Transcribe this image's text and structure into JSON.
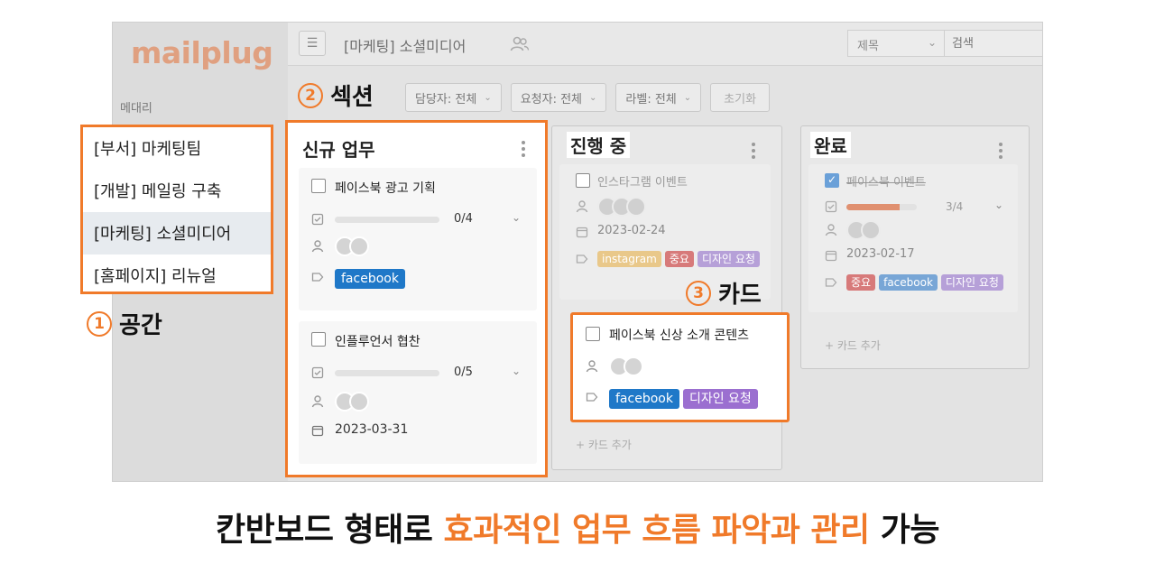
{
  "app": {
    "logo": "mailplug",
    "sidebar_label": "메대리"
  },
  "topbar": {
    "space_title": "[마케팅] 소셜미디어",
    "search_select": "제목",
    "search_placeholder": "검색",
    "icons": [
      "menu-collapse-icon",
      "people-icon",
      "chevron-down-icon"
    ]
  },
  "filters": [
    {
      "label": "담당자: 전체"
    },
    {
      "label": "요청자: 전체"
    },
    {
      "label": "라벨: 전체"
    }
  ],
  "reset_label": "초기화",
  "spaces": [
    {
      "label": "[부서] 마케팅팀",
      "active": false
    },
    {
      "label": "[개발] 메일링 구축",
      "active": false
    },
    {
      "label": "[마케팅] 소셜미디어",
      "active": true
    },
    {
      "label": "[홈페이지] 리뉴얼",
      "active": false
    }
  ],
  "columns": {
    "new": {
      "title": "신규 업무",
      "cards": [
        {
          "title": "페이스북 광고 기획",
          "progress_text": "0/4",
          "progress": 0,
          "tags": [
            {
              "label": "facebook",
              "color": "#1f78c8"
            }
          ]
        },
        {
          "title": "인플루언서 협찬",
          "progress_text": "0/5",
          "progress": 0,
          "date": "2023-03-31"
        }
      ]
    },
    "doing": {
      "title": "진행 중",
      "add_label": "+ 카드 추가",
      "cards": [
        {
          "title": "인스타그램 이벤트",
          "date": "2023-02-24",
          "tags": [
            {
              "label": "instagram",
              "color": "#e9c88a"
            },
            {
              "label": "중요",
              "color": "#d77a7a"
            },
            {
              "label": "디자인 요청",
              "color": "#b6a0d8"
            }
          ]
        },
        {
          "title": "페이스북 신상 소개 콘텐츠",
          "tags": [
            {
              "label": "facebook",
              "color": "#1f78c8"
            },
            {
              "label": "디자인 요청",
              "color": "#9b6fd0"
            }
          ]
        }
      ]
    },
    "done": {
      "title": "완료",
      "add_label": "+ 카드 추가",
      "cards": [
        {
          "title": "페이스북 이벤트",
          "progress_text": "3/4",
          "progress": 0.75,
          "date": "2023-02-17",
          "tags": [
            {
              "label": "중요",
              "color": "#d77a7a"
            },
            {
              "label": "facebook",
              "color": "#78a6d6"
            },
            {
              "label": "디자인 요청",
              "color": "#b6a0d8"
            }
          ]
        }
      ]
    }
  },
  "callouts": {
    "space": {
      "num": "1",
      "label": "공간"
    },
    "section": {
      "num": "2",
      "label": "섹션"
    },
    "card": {
      "num": "3",
      "label": "카드"
    }
  },
  "headline": {
    "pre": "칸반보드 형태로 ",
    "accent": "효과적인 업무 흐름 파악과 관리",
    "post": " 가능"
  },
  "colors": {
    "accent": "#f07a2a",
    "logo": "#e0a080"
  }
}
